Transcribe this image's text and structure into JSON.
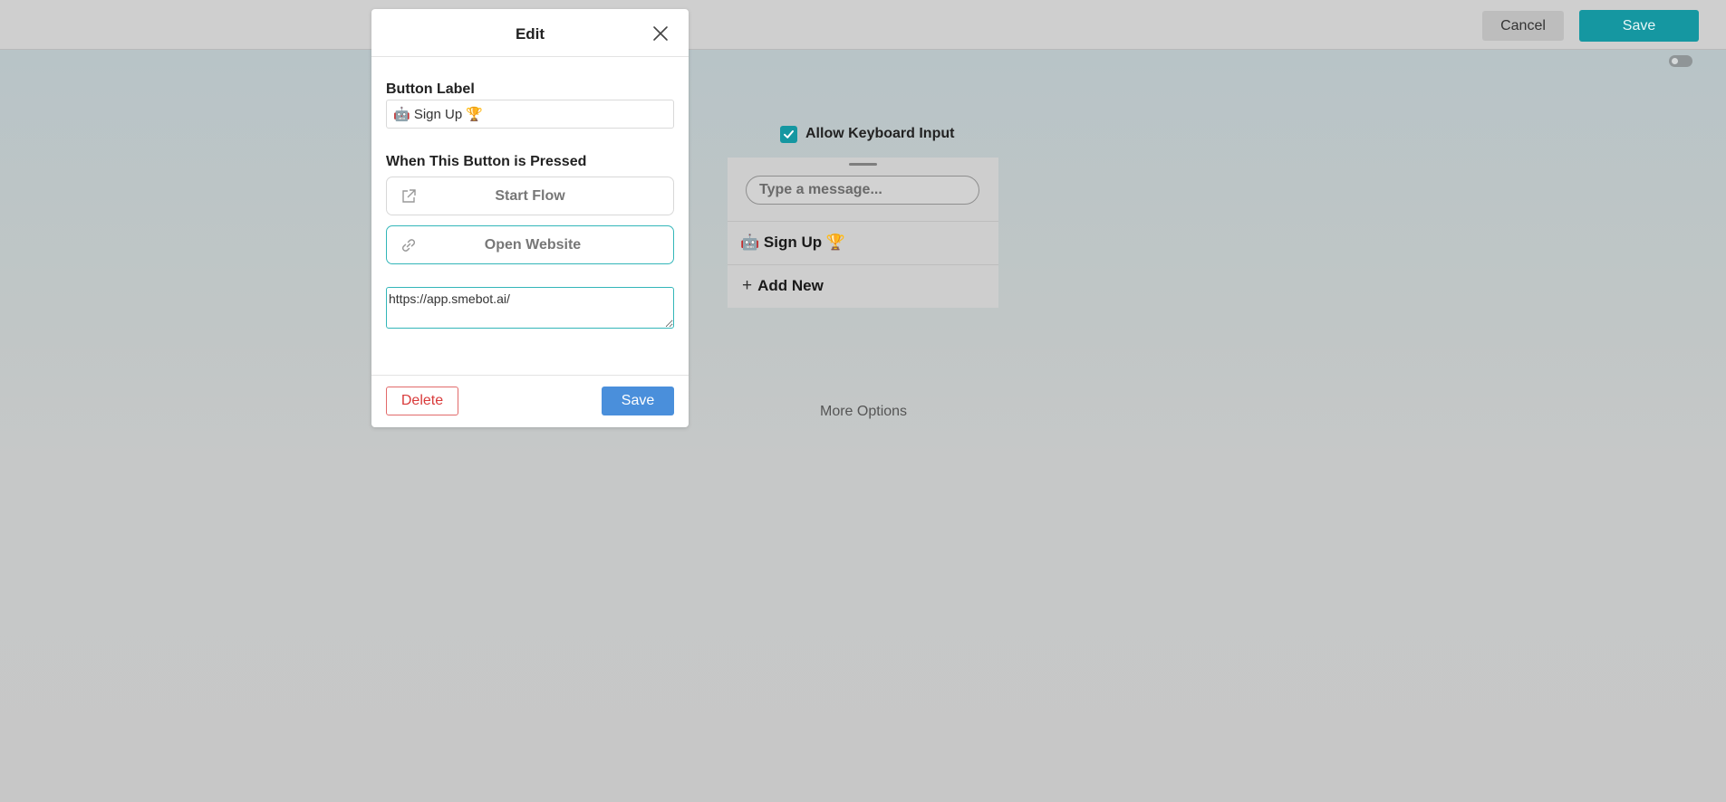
{
  "topbar": {
    "cancel_label": "Cancel",
    "save_label": "Save"
  },
  "canvas": {
    "allow_keyboard_label": "Allow Keyboard Input",
    "allow_keyboard_checked": true,
    "message_placeholder": "Type a message...",
    "buttons": [
      {
        "label": "🤖 Sign Up 🏆"
      }
    ],
    "add_new_label": "Add New",
    "more_options_label": "More Options"
  },
  "modal": {
    "title": "Edit",
    "button_label_heading": "Button Label",
    "button_label_value": "🤖 Sign Up 🏆",
    "when_pressed_heading": "When This Button is Pressed",
    "actions": [
      {
        "label": "Start Flow",
        "icon": "external-link-icon",
        "selected": false
      },
      {
        "label": "Open Website",
        "icon": "link-icon",
        "selected": true
      }
    ],
    "url_value": "https://app.smebot.ai/",
    "delete_label": "Delete",
    "save_label": "Save"
  },
  "colors": {
    "accent": "#1597a1",
    "primary_blue": "#4a8fdb",
    "danger": "#d93a3a",
    "selected_border": "#33b6b9"
  }
}
